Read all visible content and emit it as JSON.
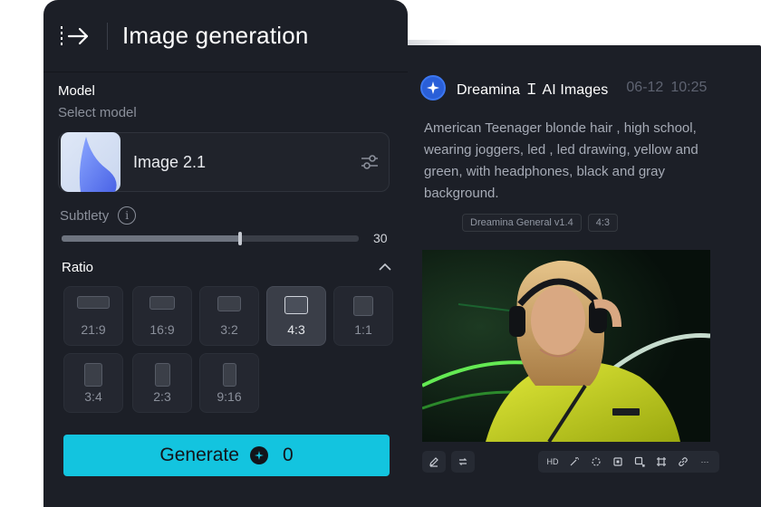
{
  "panel": {
    "title": "Image generation",
    "model_label": "Model",
    "model_sub": "Select model",
    "model_name": "Image 2.1",
    "subtlety_label": "Subtlety",
    "subtlety_value": "30",
    "subtlety_fraction": 0.6,
    "ratio_label": "Ratio",
    "ratios": [
      {
        "label": "21:9",
        "w": 36,
        "h": 14,
        "selected": false
      },
      {
        "label": "16:9",
        "w": 28,
        "h": 15,
        "selected": false
      },
      {
        "label": "3:2",
        "w": 26,
        "h": 17,
        "selected": false
      },
      {
        "label": "4:3",
        "w": 26,
        "h": 20,
        "selected": true
      },
      {
        "label": "1:1",
        "w": 22,
        "h": 22,
        "selected": false
      },
      {
        "label": "3:4",
        "w": 20,
        "h": 26,
        "selected": false
      },
      {
        "label": "2:3",
        "w": 17,
        "h": 26,
        "selected": false
      },
      {
        "label": "9:16",
        "w": 15,
        "h": 26,
        "selected": false
      }
    ],
    "generate_label": "Generate",
    "generate_count": "0"
  },
  "result": {
    "brand": "Dreamina Ｉ AI Images",
    "date": "06-12",
    "time": "10:25",
    "prompt": "American Teenager blonde hair , high school, wearing joggers, led , led drawing, yellow and green, with headphones, black and gray background.",
    "tags": [
      "Dreamina General v1.4",
      "4:3"
    ],
    "tools": [
      {
        "name": "hd-icon",
        "text": "HD"
      },
      {
        "name": "magic-wand-icon",
        "text": ""
      },
      {
        "name": "eraser-icon",
        "text": ""
      },
      {
        "name": "expand-icon",
        "text": ""
      },
      {
        "name": "extend-icon",
        "text": ""
      },
      {
        "name": "crop-icon",
        "text": ""
      },
      {
        "name": "link-icon",
        "text": ""
      },
      {
        "name": "more-icon",
        "text": "···"
      }
    ]
  },
  "colors": {
    "panel_bg": "#1c1f27",
    "accent": "#13c4df",
    "brand_blue": "#2a5fd8"
  }
}
